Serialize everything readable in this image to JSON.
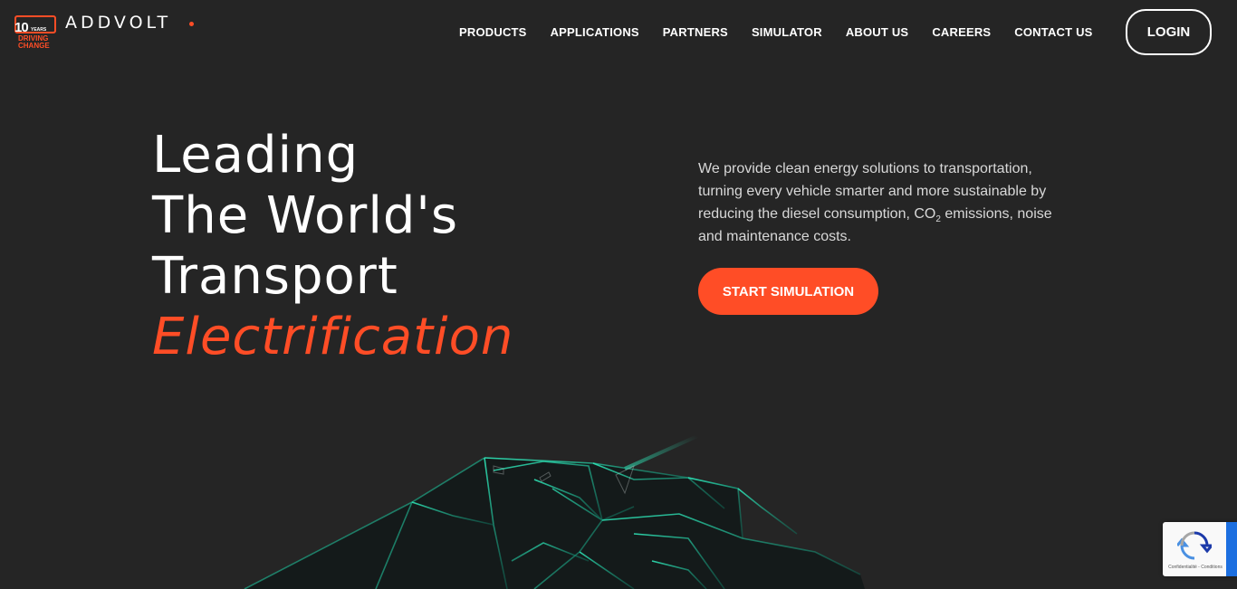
{
  "brand": {
    "badge_number": "10",
    "badge_years": "YEARS",
    "badge_line1": "DRIVING",
    "badge_line2": "CHANGE",
    "wordmark": "ADDVOLT"
  },
  "nav": {
    "items": [
      {
        "label": "PRODUCTS"
      },
      {
        "label": "APPLICATIONS"
      },
      {
        "label": "PARTNERS"
      },
      {
        "label": "SIMULATOR"
      },
      {
        "label": "ABOUT US"
      },
      {
        "label": "CAREERS"
      },
      {
        "label": "CONTACT US"
      }
    ],
    "login_label": "LOGIN"
  },
  "hero": {
    "line1": "Leading",
    "line2": "The World's",
    "line3": "Transport",
    "accent": "Electrification",
    "desc_before": "We provide clean energy solutions to transportation, turning every vehicle smarter and more sustainable by reducing the diesel consumption, CO",
    "desc_sub": "2",
    "desc_after": " emissions, noise and maintenance costs.",
    "cta_label": "START SIMULATION"
  },
  "recaptcha": {
    "text": "Confidentialité - Conditions"
  },
  "colors": {
    "background": "#252525",
    "accent": "#ff4d26",
    "truck_lines": "#2fe6b8"
  }
}
